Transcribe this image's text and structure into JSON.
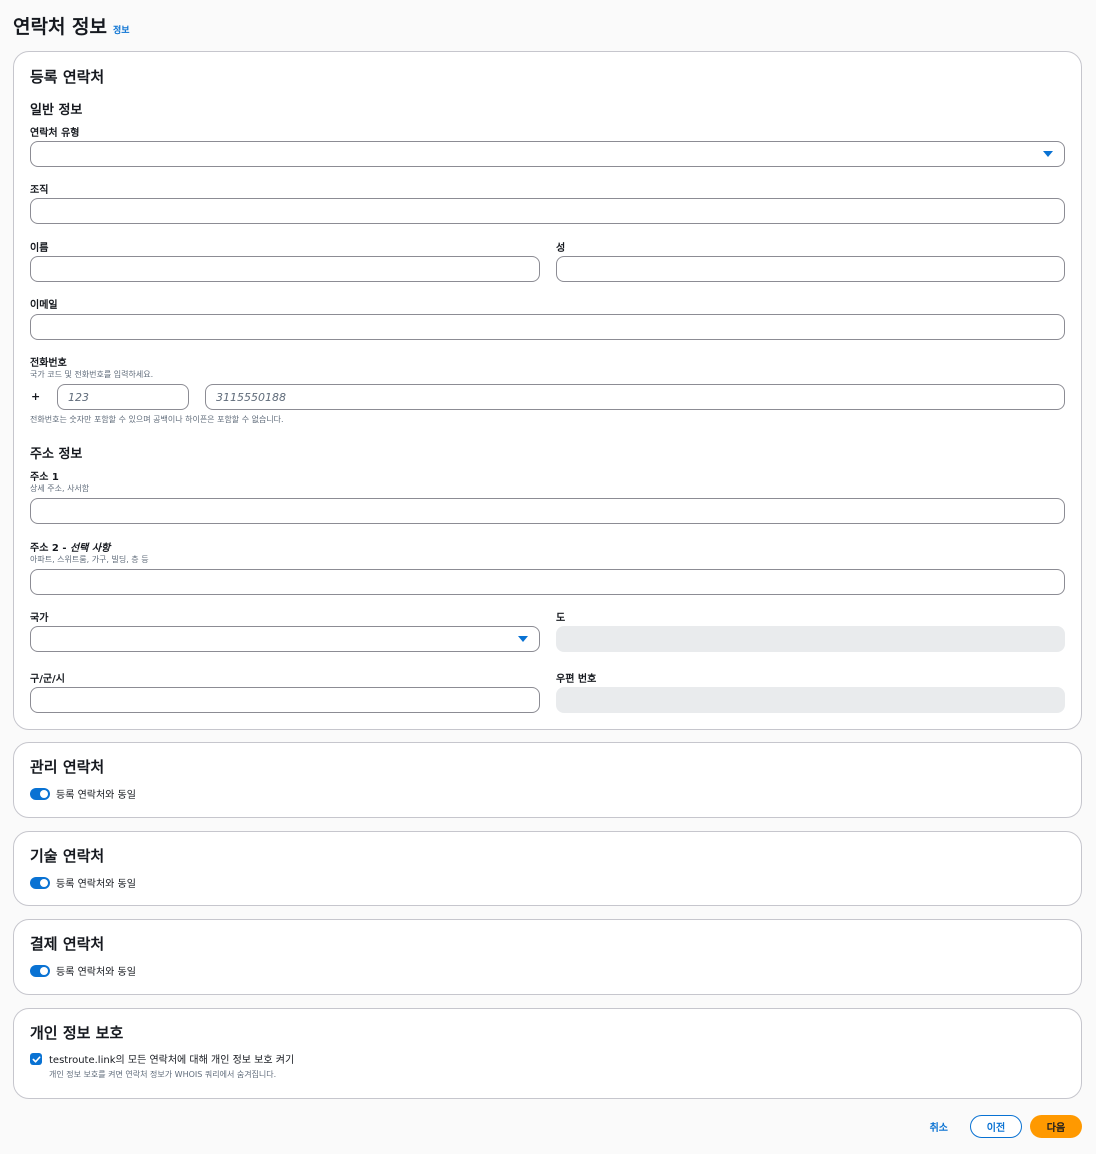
{
  "header": {
    "title": "연락처 정보",
    "info_link": "정보"
  },
  "registrant": {
    "title": "등록 연락처",
    "general_section": "일반 정보",
    "contact_type_label": "연락처 유형",
    "contact_type_value": "",
    "org_label": "조직",
    "first_name_label": "이름",
    "last_name_label": "성",
    "email_label": "이메일",
    "phone_label": "전화번호",
    "phone_desc": "국가 코드 및 전화번호를 입력하세요.",
    "phone_plus": "+",
    "country_code_placeholder": "123",
    "phone_placeholder": "3115550188",
    "phone_hint": "전화번호는 숫자만 포함할 수 있으며 공백이나 하이픈은 포함할 수 없습니다.",
    "address_section": "주소 정보",
    "address1_label": "주소 1",
    "address1_desc": "상세 주소, 사서함",
    "address2_label": "주소 2 - ",
    "address2_optional": "선택 사항",
    "address2_desc": "아파트, 스위트룸, 가구, 빌딩, 층 등",
    "country_label": "국가",
    "state_label": "도",
    "city_label": "구/군/시",
    "postal_label": "우편 번호"
  },
  "admin": {
    "title": "관리 연락처",
    "toggle_label": "등록 연락처와 동일",
    "toggle_on": true
  },
  "tech": {
    "title": "기술 연락처",
    "toggle_label": "등록 연락처와 동일",
    "toggle_on": true
  },
  "billing": {
    "title": "결제 연락처",
    "toggle_label": "등록 연락처와 동일",
    "toggle_on": true
  },
  "privacy": {
    "title": "개인 정보 보호",
    "checkbox_label": "testroute.link의 모든 연락처에 대해 개인 정보 보호 켜기",
    "checkbox_desc": "개인 정보 보호를 켜면 연락처 정보가 WHOIS 쿼리에서 숨겨집니다.",
    "checked": true
  },
  "footer": {
    "cancel": "취소",
    "previous": "이전",
    "next": "다음"
  },
  "colors": {
    "accent": "#0972d3",
    "primary_button": "#ff9900",
    "border": "#c6c6cd"
  }
}
